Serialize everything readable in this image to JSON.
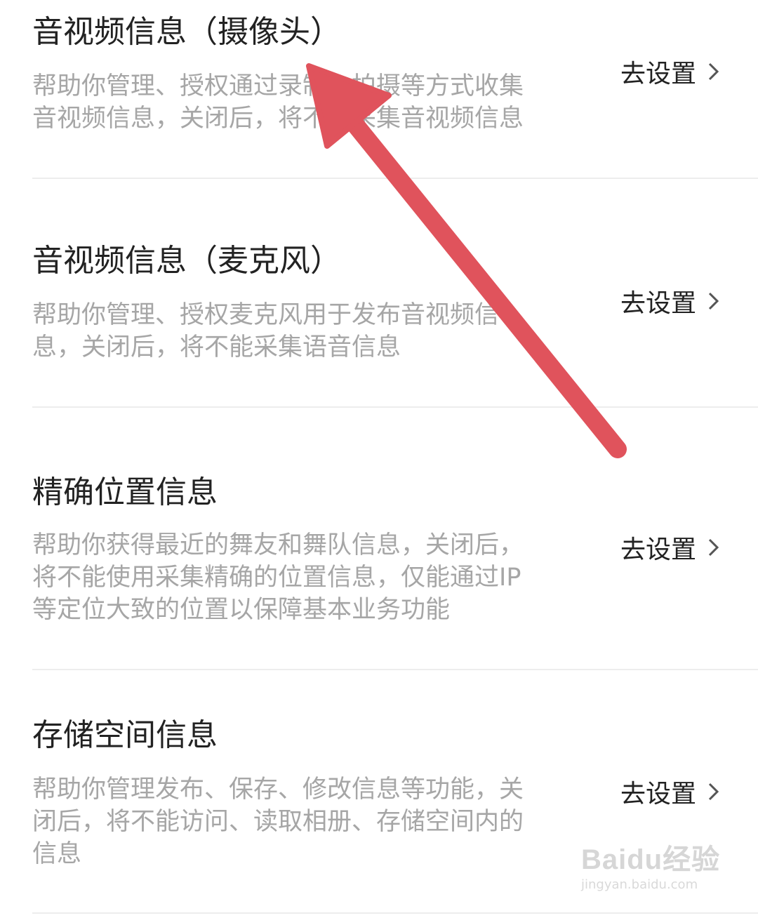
{
  "action_label": "去设置",
  "items": [
    {
      "title": "音视频信息（摄像头）",
      "desc_lines": [
        "帮助你管理、授权通过录制、拍摄等方式收集",
        "音视频信息，关闭后，将不能采集音视频信息"
      ]
    },
    {
      "title": "音视频信息（麦克风）",
      "desc_lines": [
        "帮助你管理、授权麦克风用于发布音视频信",
        "息，关闭后，将不能采集语音信息"
      ]
    },
    {
      "title": "精确位置信息",
      "desc_lines": [
        "帮助你获得最近的舞友和舞队信息，关闭后，",
        "将不能使用采集精确的位置信息，仅能通过IP",
        "等定位大致的位置以保障基本业务功能"
      ]
    },
    {
      "title": "存储空间信息",
      "desc_lines": [
        "帮助你管理发布、保存、修改信息等功能，关",
        "闭后，将不能访问、读取相册、存储空间内的",
        "信息"
      ]
    }
  ],
  "annotation": {
    "arrow_color": "#e0535c"
  },
  "watermark": {
    "logo": "Baidu经验",
    "sub": "jingyan.baidu.com"
  },
  "icons": {
    "chevron": "chevron-right-icon",
    "arrow": "annotation-arrow-icon"
  }
}
